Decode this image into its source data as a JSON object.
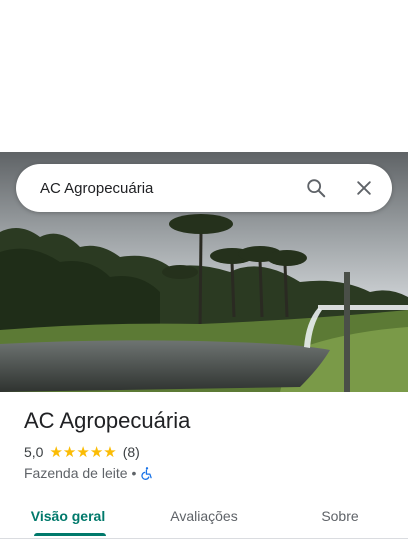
{
  "search": {
    "query": "AC Agropecuária"
  },
  "place": {
    "title": "AC Agropecuária",
    "rating": "5,0",
    "stars": 5,
    "review_count": "(8)",
    "category": "Fazenda de leite",
    "separator": "•"
  },
  "tabs": [
    {
      "label": "Visão geral",
      "active": true
    },
    {
      "label": "Avaliações",
      "active": false
    },
    {
      "label": "Sobre",
      "active": false
    }
  ],
  "colors": {
    "accent": "#00796b",
    "star": "#fbbc04",
    "accessibility": "#1a73e8"
  },
  "icons": [
    "search-icon",
    "close-icon",
    "star-icon",
    "wheelchair-icon"
  ]
}
